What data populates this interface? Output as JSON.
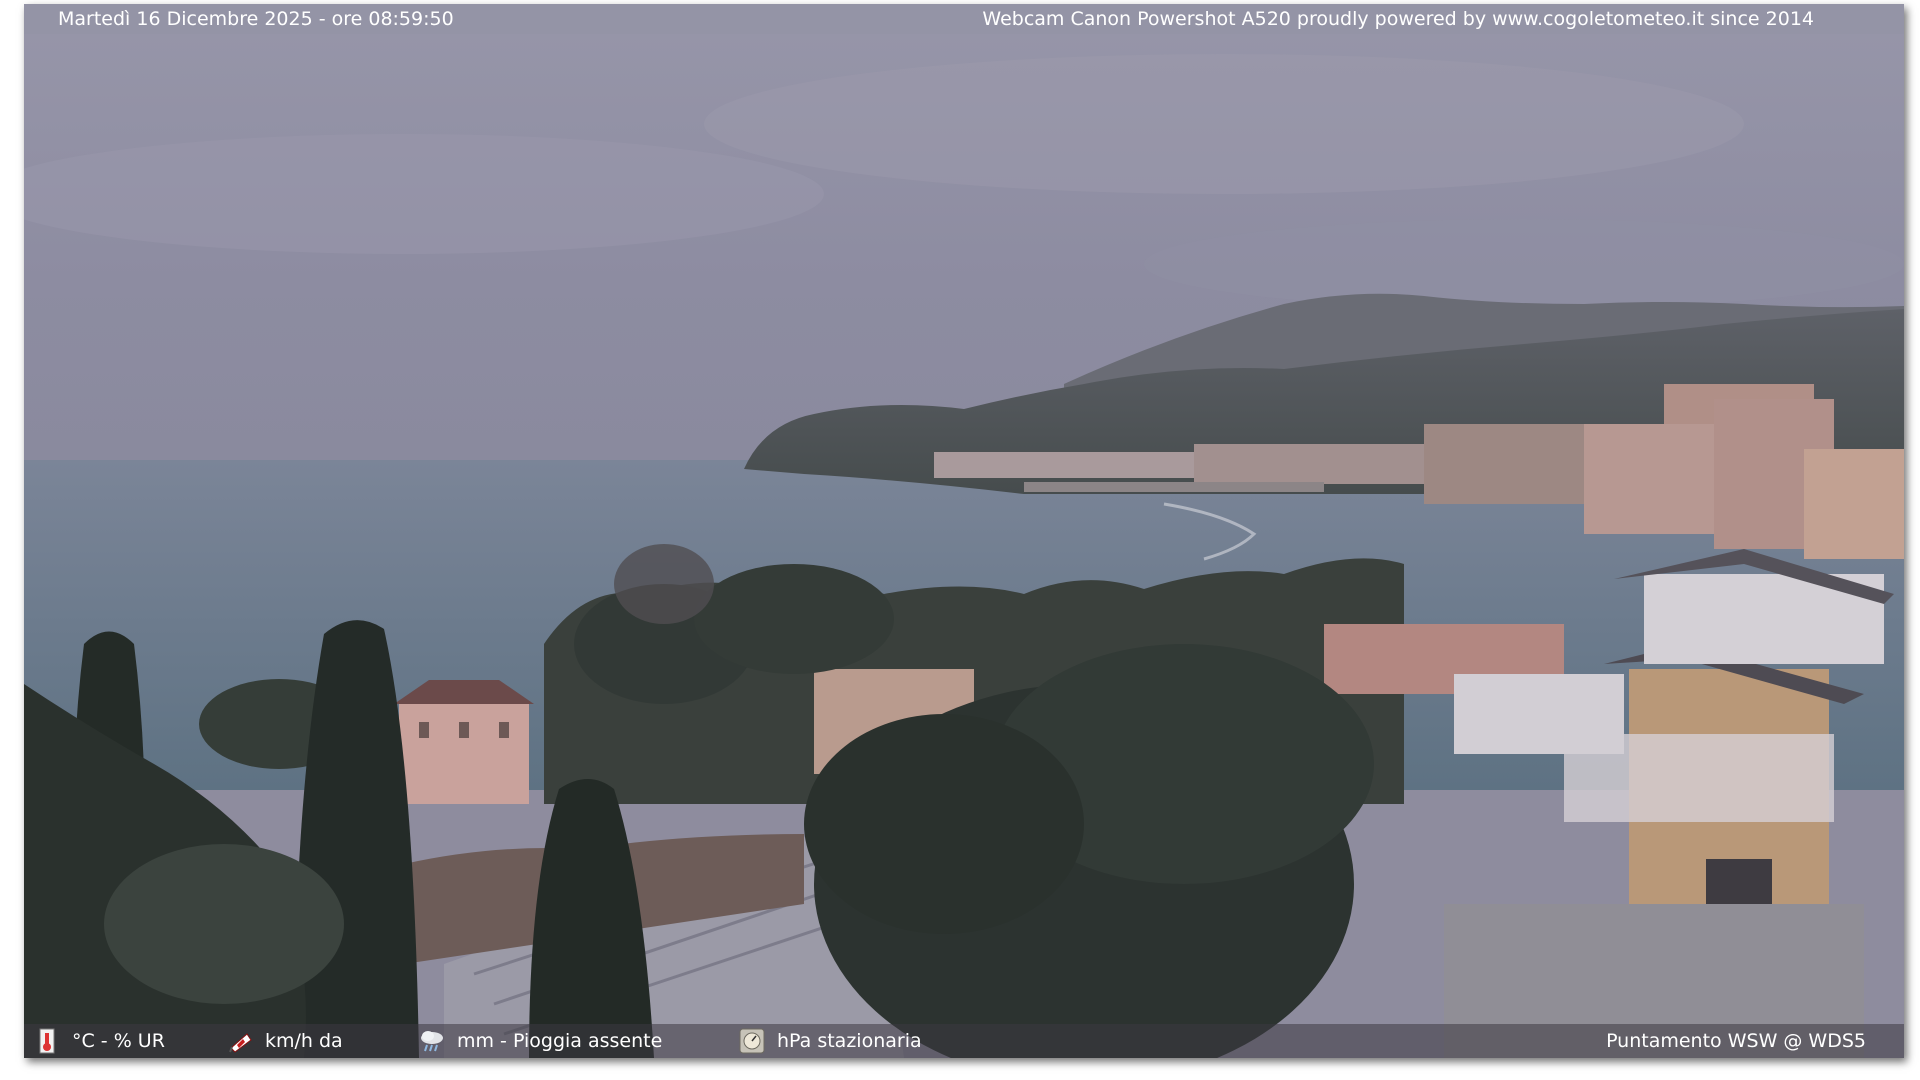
{
  "header": {
    "datetime": "Martedì 16 Dicembre 2025 - ore 08:59:50",
    "credit": "Webcam Canon Powershot A520 proudly powered by www.cogoletometeo.it since 2014"
  },
  "footer": {
    "temperature": {
      "icon": "thermometer-icon",
      "text": "°C - % UR"
    },
    "wind": {
      "icon": "windsock-icon",
      "text": "km/h da"
    },
    "rain": {
      "icon": "rain-cloud-icon",
      "text": "mm - Pioggia assente"
    },
    "pressure": {
      "icon": "barometer-icon",
      "text": "hPa stazionaria"
    },
    "pointing": "Puntamento WSW  @ WDS5"
  },
  "colors": {
    "sky": "#8f8ea3",
    "sea": "#6b7c8f",
    "hills": "#4f5459",
    "trees": "#2d3430",
    "buildings": "#c8a79c"
  }
}
